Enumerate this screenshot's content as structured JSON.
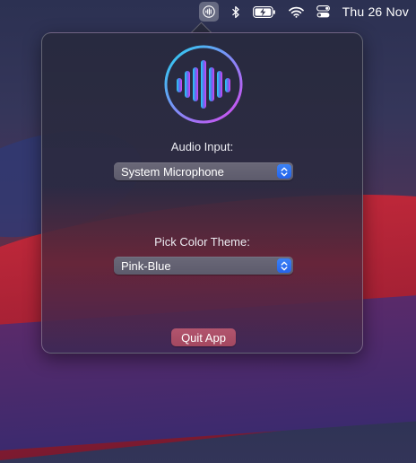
{
  "menubar": {
    "clock": "Thu 26 Nov",
    "icons": [
      "waveform-app-icon",
      "bluetooth-icon",
      "battery-charging-icon",
      "wifi-icon",
      "control-center-icon"
    ]
  },
  "popover": {
    "audio_input": {
      "label": "Audio Input:",
      "selected": "System Microphone"
    },
    "color_theme": {
      "label": "Pick Color Theme:",
      "selected": "Pink-Blue"
    },
    "quit_label": "Quit App"
  },
  "colors": {
    "accent_blue": "#2f7cf6",
    "logo_cyan": "#22d3ee",
    "logo_magenta": "#d946ef",
    "quit_button": "#a9506a"
  }
}
